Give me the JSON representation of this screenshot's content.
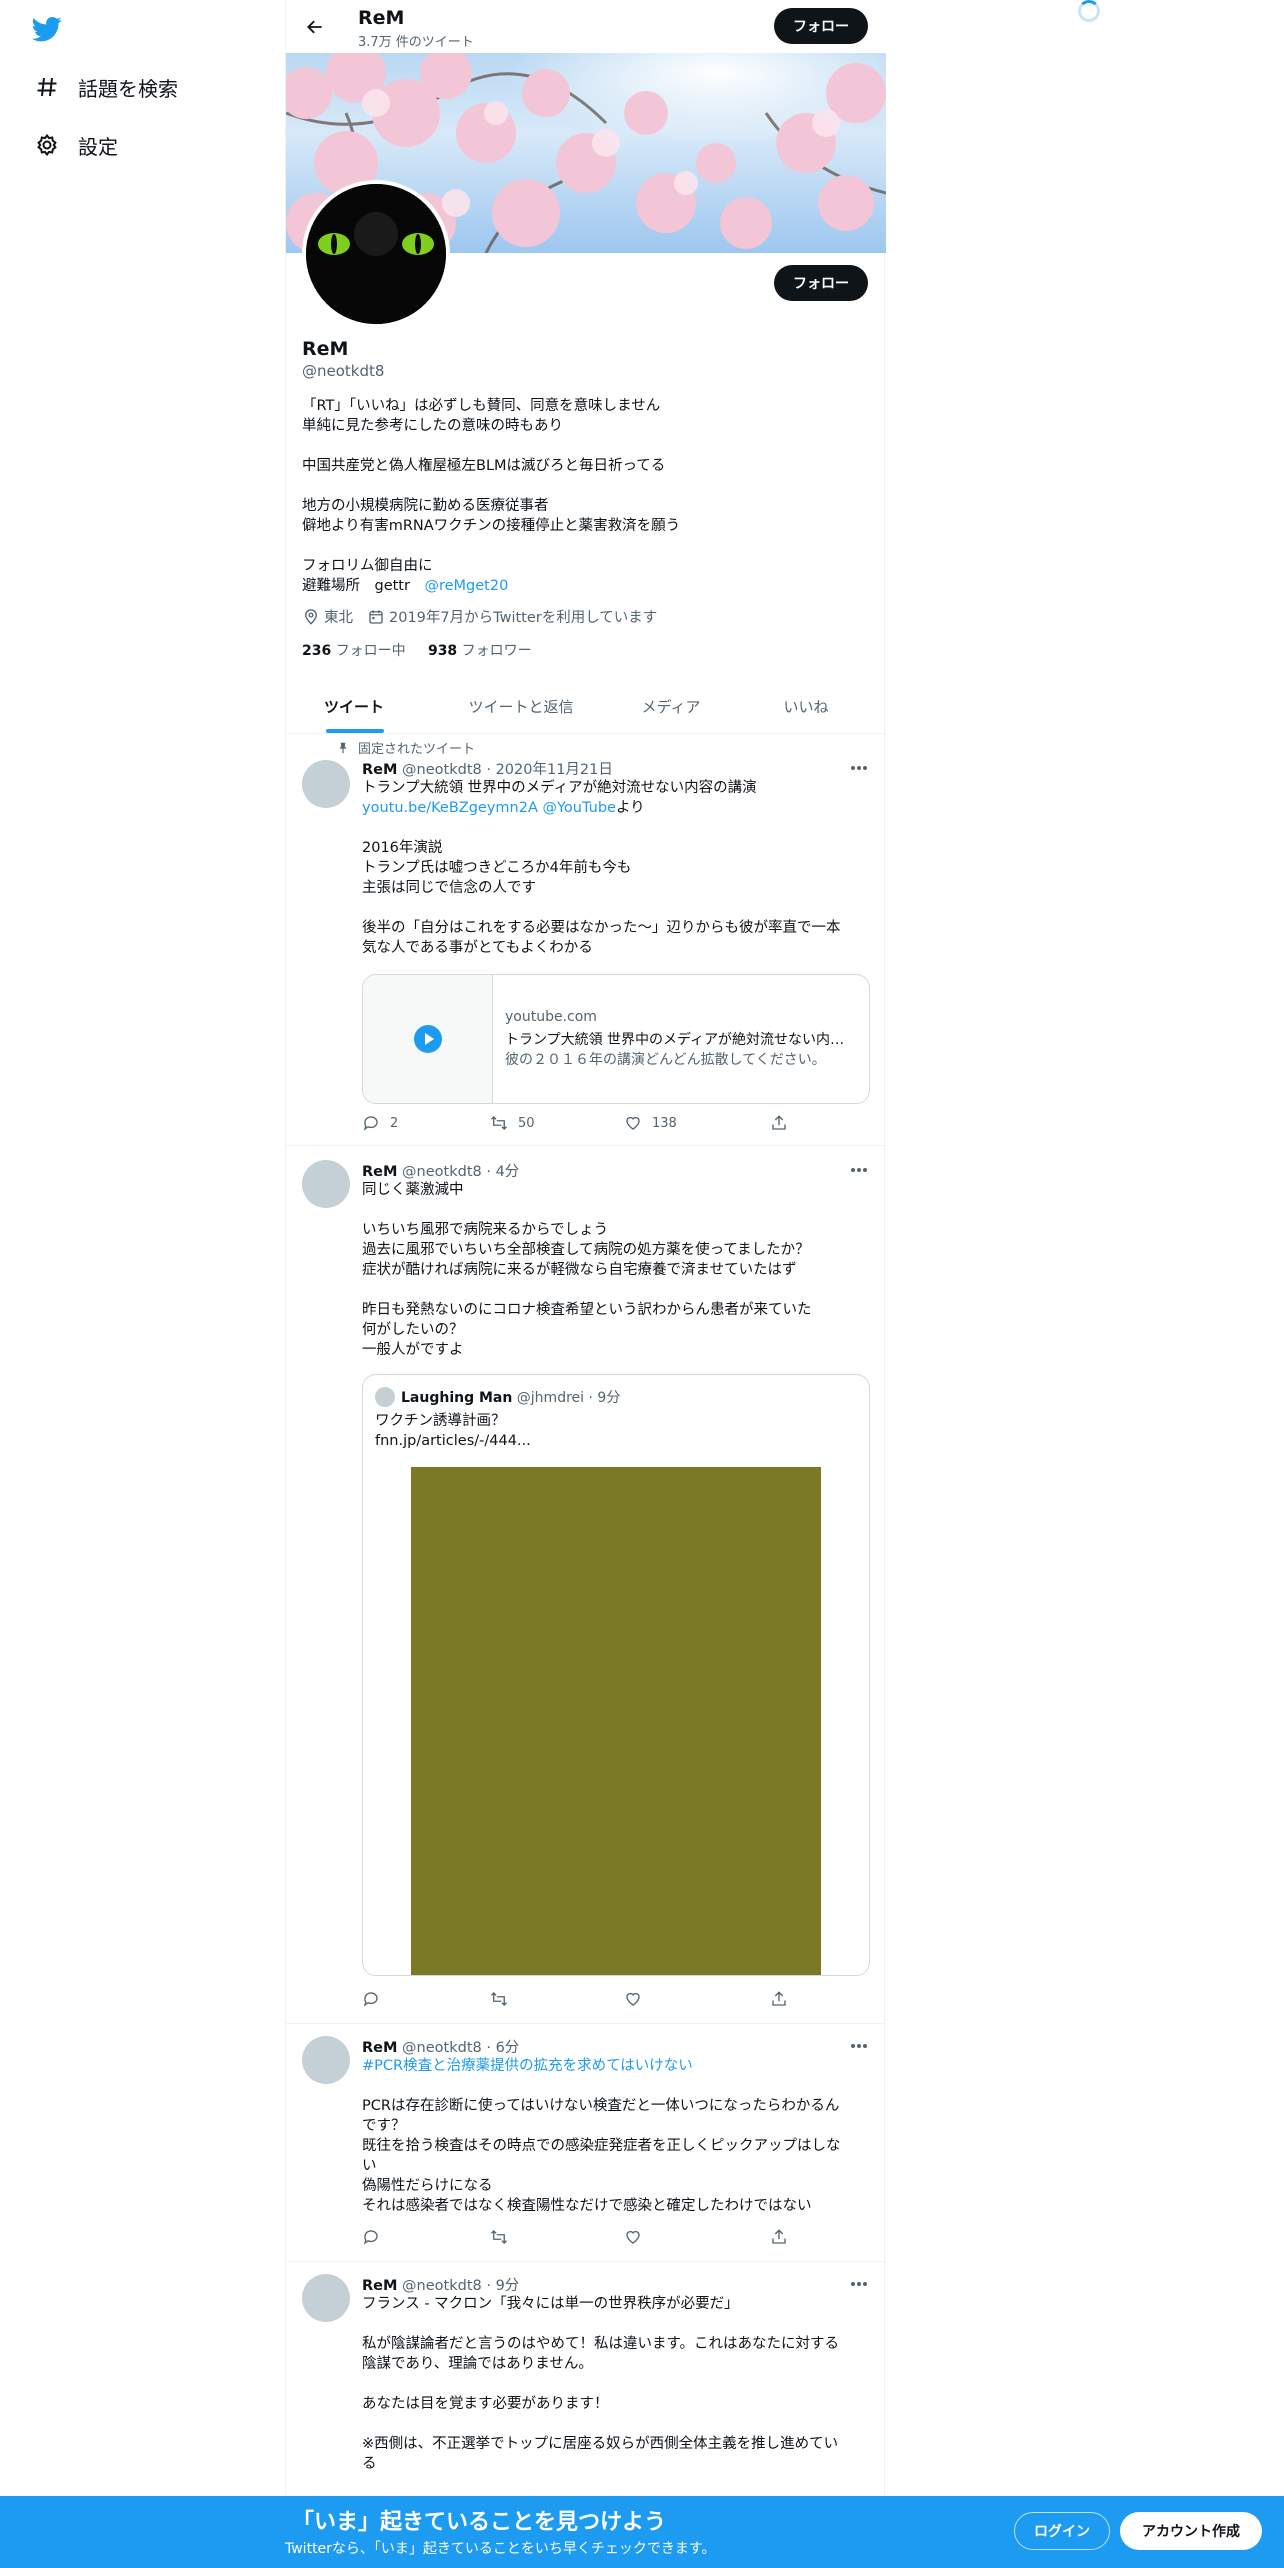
{
  "nav": {
    "items": [
      {
        "label": "話題を検索",
        "icon": "hashtag-icon"
      },
      {
        "label": "設定",
        "icon": "gear-icon"
      }
    ]
  },
  "header": {
    "name": "ReM",
    "tweet_count": "3.7万 件のツイート",
    "follow_label": "フォロー"
  },
  "profile": {
    "name": "ReM",
    "handle": "@neotkdt8",
    "follow_label": "フォロー",
    "bio_lines": [
      "「RT」「いいね」は必ずしも賛同、同意を意味しません",
      "単純に見た参考にしたの意味の時もあり",
      "",
      "中国共産党と偽人権屋極左BLMは滅びろと毎日祈ってる",
      "",
      "地方の小規模病院に勤める医療従事者",
      "僻地より有害mRNAワクチンの接種停止と薬害救済を願う",
      "",
      "フォロリム御自由に"
    ],
    "bio_last_prefix": "避難場所　gettr　",
    "bio_last_link": "@reMget20",
    "location": "東北",
    "joined": "2019年7月からTwitterを利用しています",
    "following_count": "236",
    "following_label": "フォロー中",
    "followers_count": "938",
    "followers_label": "フォロワー"
  },
  "tabs": [
    "ツイート",
    "ツイートと返信",
    "メディア",
    "いいね"
  ],
  "tweets": [
    {
      "pinned_label": "固定されたツイート",
      "name": "ReM",
      "handle": "@neotkdt8",
      "time": "2020年11月21日",
      "line1": "トランプ大統領 世界中のメディアが絶対流せない内容の講演",
      "link1": "youtu.be/KeBZgeymn2A",
      "link2": "@YouTube",
      "link_suffix": "より",
      "lines": [
        "",
        "2016年演説",
        "トランプ氏は嘘つきどころか4年前も今も",
        "主張は同じで信念の人です",
        "",
        "後半の「自分はこれをする必要はなかった～」辺りからも彼が率直で一本",
        "気な人である事がとてもよくわかる"
      ],
      "card": {
        "domain": "youtube.com",
        "title": "トランプ大統領 世界中のメディアが絶対流せない内容の講演",
        "desc": "彼の２０１６年の講演どんどん拡散してください。"
      },
      "replies": "2",
      "retweets": "50",
      "likes": "138"
    },
    {
      "name": "ReM",
      "handle": "@neotkdt8",
      "time": "4分",
      "lines": [
        "同じく薬激減中",
        "",
        "いちいち風邪で病院来るからでしょう",
        "過去に風邪でいちいち全部検査して病院の処方薬を使ってましたか？",
        "症状が酷ければ病院に来るが軽微なら自宅療養で済ませていたはず",
        "",
        "昨日も発熱ないのにコロナ検査希望という訳わからん患者が来ていた",
        "何がしたいの？",
        "一般人がですよ"
      ],
      "quote": {
        "name": "Laughing Man",
        "handle": "@jhmdrei",
        "time": "9分",
        "line1": "ワクチン誘導計画？",
        "line2": "fnn.jp/articles/-/444..."
      }
    },
    {
      "name": "ReM",
      "handle": "@neotkdt8",
      "time": "6分",
      "hashtag": "#PCR検査と治療薬提供の拡充を求めてはいけない",
      "lines": [
        "",
        "PCRは存在診断に使ってはいけない検査だと一体いつになったらわかるん",
        "です？",
        "既往を拾う検査はその時点での感染症発症者を正しくピックアップはしな",
        "い",
        "偽陽性だらけになる",
        "それは感染者ではなく検査陽性なだけで感染と確定したわけではない"
      ]
    },
    {
      "name": "ReM",
      "handle": "@neotkdt8",
      "time": "9分",
      "lines": [
        "フランス - マクロン「我々には単一の世界秩序が必要だ」",
        "",
        "私が陰謀論者だと言うのはやめて！私は違います。これはあなたに対する",
        "陰謀であり、理論ではありません。",
        "",
        "あなたは目を覚ます必要があります！",
        "",
        "※西側は、不正選挙でトップに居座る奴らが西側全体主義を推し進めてい",
        "る"
      ]
    }
  ],
  "bottom": {
    "title": "「いま」起きていることを見つけよう",
    "subtitle": "Twitterなら、「いま」起きていることをいち早くチェックできます。",
    "login": "ログイン",
    "signup": "アカウント作成"
  },
  "colors": {
    "accent": "#1d9bf0",
    "text": "#0f1419",
    "muted": "#536471",
    "border": "#eff3f4"
  }
}
